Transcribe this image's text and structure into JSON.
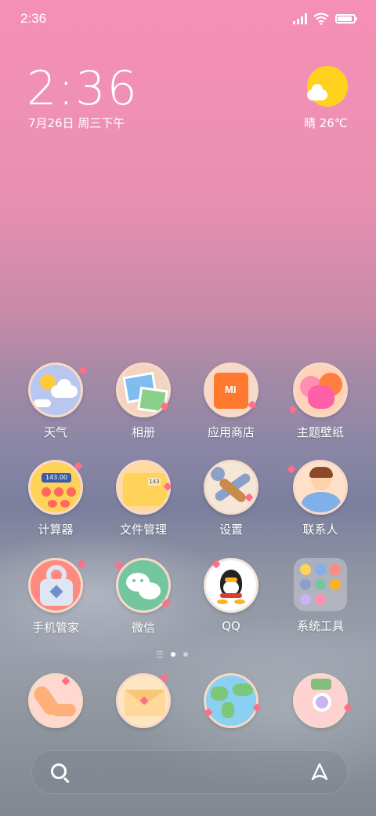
{
  "status_bar": {
    "time": "2:36",
    "battery_level": 0.9,
    "signal_bars": 4
  },
  "clock": {
    "time": "2:36",
    "date": "7月26日 周三下午"
  },
  "weather": {
    "text": "晴 26℃",
    "icon": "sunny-cloud-icon"
  },
  "apps": [
    {
      "label": "天气",
      "icon": "weather-icon"
    },
    {
      "label": "相册",
      "icon": "gallery-icon"
    },
    {
      "label": "应用商店",
      "icon": "app-store-icon",
      "icon_text": "MI"
    },
    {
      "label": "主题壁纸",
      "icon": "themes-icon"
    },
    {
      "label": "计算器",
      "icon": "calculator-icon",
      "icon_text": "143.00"
    },
    {
      "label": "文件管理",
      "icon": "file-manager-icon",
      "icon_text": "143"
    },
    {
      "label": "设置",
      "icon": "settings-icon"
    },
    {
      "label": "联系人",
      "icon": "contacts-icon"
    },
    {
      "label": "手机管家",
      "icon": "security-icon"
    },
    {
      "label": "微信",
      "icon": "wechat-icon"
    },
    {
      "label": "QQ",
      "icon": "qq-icon"
    },
    {
      "label": "系统工具",
      "icon": "system-tools-folder-icon"
    }
  ],
  "page_indicator": {
    "pages": 2,
    "current": 1
  },
  "dock": [
    {
      "icon": "phone-icon"
    },
    {
      "icon": "messages-icon"
    },
    {
      "icon": "browser-icon"
    },
    {
      "icon": "camera-icon"
    }
  ],
  "search_bar": {
    "search_icon": "search-icon",
    "assistant_icon": "assistant-icon"
  },
  "colors": {
    "accent_pink": "#f58fb5",
    "heart": "#ff6f8a",
    "sun": "#ffd21f"
  }
}
